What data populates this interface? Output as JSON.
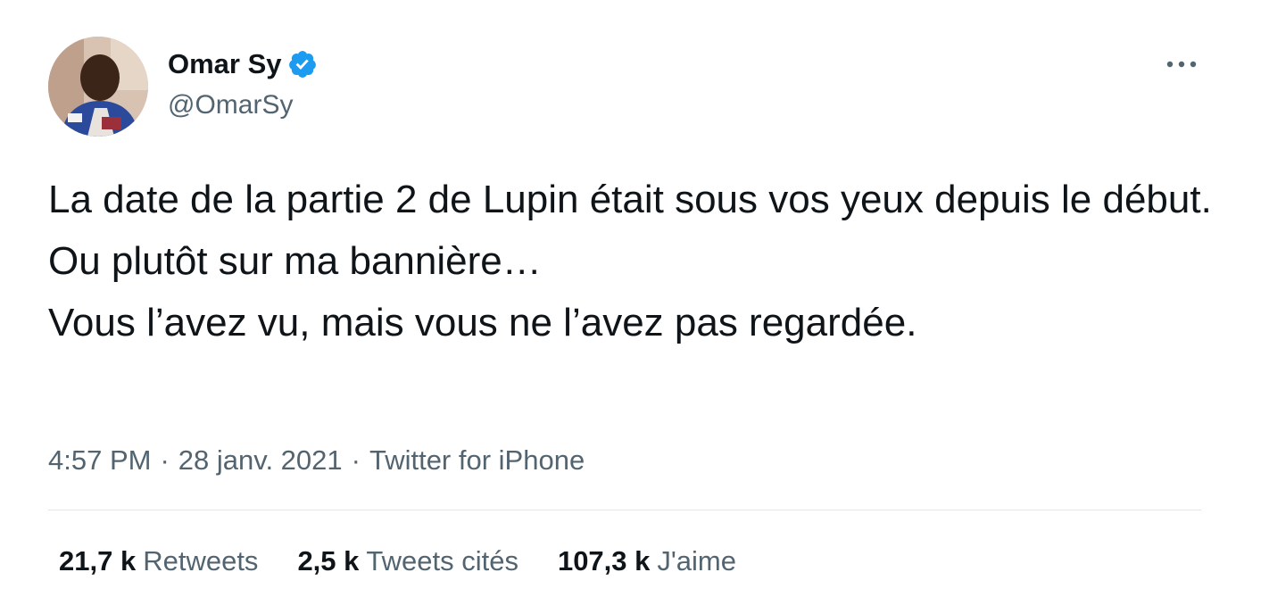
{
  "author": {
    "display_name": "Omar Sy",
    "handle": "@OmarSy",
    "verified_icon": "verified-badge-icon",
    "verified_color": "#1d9bf0"
  },
  "menu": {
    "icon": "more-horizontal-icon"
  },
  "tweet": {
    "lines": [
      "La date de la partie 2 de Lupin était sous vos yeux depuis le début.",
      "Ou plutôt sur ma bannière…",
      "Vous l’avez vu, mais vous ne l’avez pas regardée."
    ]
  },
  "meta": {
    "time": "4:57 PM",
    "separator": "·",
    "date": "28 janv. 2021",
    "source": "Twitter for iPhone"
  },
  "stats": [
    {
      "value": "21,7 k",
      "label": "Retweets"
    },
    {
      "value": "2,5 k",
      "label": "Tweets cités"
    },
    {
      "value": "107,3 k",
      "label": "J'aime"
    }
  ],
  "colors": {
    "text_primary": "#0f1419",
    "text_secondary": "#536471",
    "divider": "#e1e6ea"
  }
}
